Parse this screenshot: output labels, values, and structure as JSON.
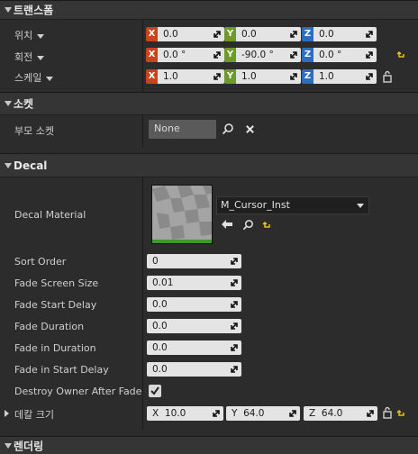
{
  "transform": {
    "title": "트랜스폼",
    "location": {
      "label": "위치",
      "x": "0.0",
      "y": "0.0",
      "z": "0.0"
    },
    "rotation": {
      "label": "회전",
      "x": "0.0 °",
      "y": "-90.0 °",
      "z": "0.0 °"
    },
    "scale": {
      "label": "스케일",
      "x": "1.0",
      "y": "1.0",
      "z": "1.0"
    },
    "axis_labels": {
      "x": "X",
      "y": "Y",
      "z": "Z"
    }
  },
  "socket": {
    "title": "소켓",
    "parent_socket_label": "부모 소켓",
    "parent_socket_value": "None"
  },
  "decal": {
    "title": "Decal",
    "material_label": "Decal Material",
    "material_value": "M_Cursor_Inst",
    "sort_order": {
      "label": "Sort Order",
      "value": "0"
    },
    "fade_screen_size": {
      "label": "Fade Screen Size",
      "value": "0.01"
    },
    "fade_start_delay": {
      "label": "Fade Start Delay",
      "value": "0.0"
    },
    "fade_duration": {
      "label": "Fade Duration",
      "value": "0.0"
    },
    "fade_in_duration": {
      "label": "Fade in Duration",
      "value": "0.0"
    },
    "fade_in_start_delay": {
      "label": "Fade in Start Delay",
      "value": "0.0"
    },
    "destroy_owner": {
      "label": "Destroy Owner After Fade",
      "checked": true
    },
    "decal_size": {
      "label": "데칼 크기",
      "x_label": "X",
      "x": "10.0",
      "y_label": "Y",
      "y": "64.0",
      "z_label": "Z",
      "z": "64.0"
    }
  },
  "rendering": {
    "title": "렌더링"
  },
  "colors": {
    "axis_x": "#c8441f",
    "axis_y": "#6e9a28",
    "axis_z": "#2c6dc0",
    "reset_arrow": "#e8c21a"
  }
}
